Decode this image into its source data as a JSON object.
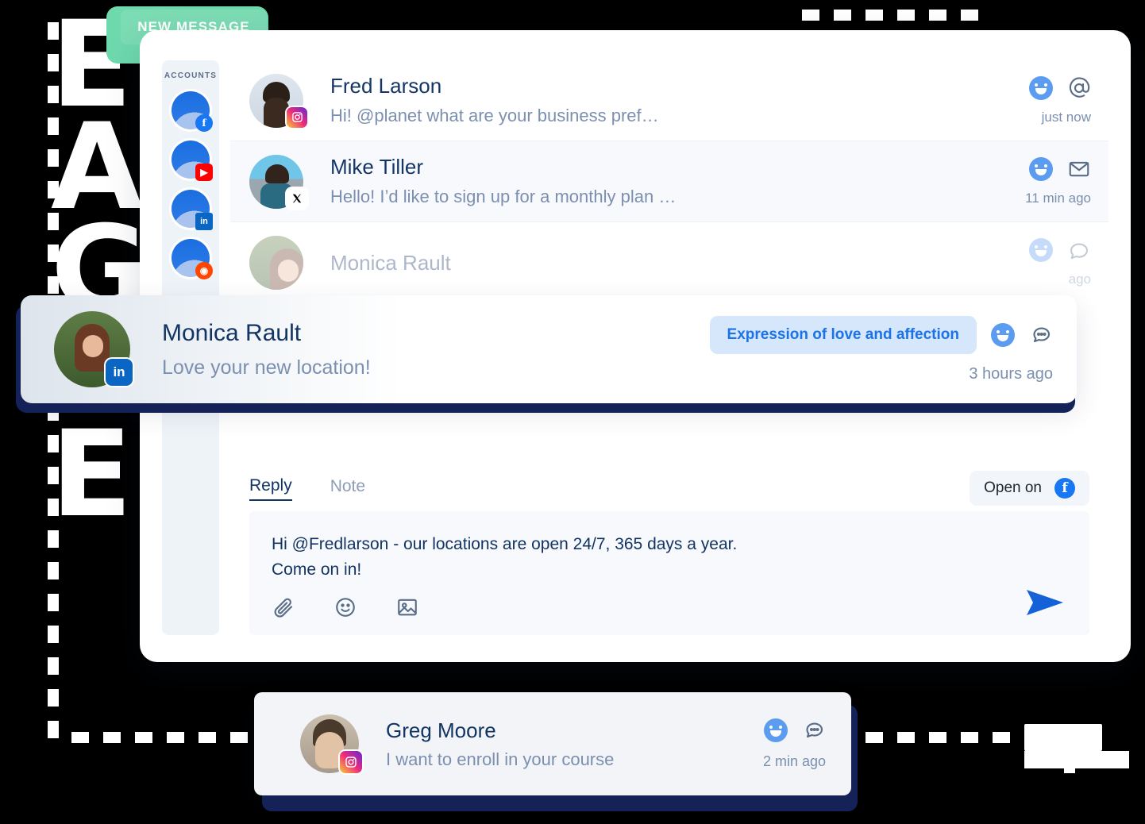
{
  "decor": {
    "ghost_letters": [
      "E",
      "A",
      "G",
      "E",
      "E"
    ],
    "new_message_badge": "NEW MESSAGE"
  },
  "sidebar": {
    "title": "ACCOUNTS",
    "items": [
      {
        "name": "account-facebook",
        "badge_icon": "facebook-icon",
        "glyph": "f"
      },
      {
        "name": "account-youtube",
        "badge_icon": "youtube-icon",
        "glyph": "▶"
      },
      {
        "name": "account-linkedin",
        "badge_icon": "linkedin-icon",
        "glyph": "in"
      },
      {
        "name": "account-reddit",
        "badge_icon": "reddit-icon",
        "glyph": "◉"
      }
    ]
  },
  "conversations": [
    {
      "name": "Fred Larson",
      "snippet": "Hi! @planet what are your business pref…",
      "platform": "instagram-icon",
      "platform_glyph": "▣",
      "time": "just now",
      "icon_primary": "smiley-icon",
      "icon_secondary": "mention-at-icon"
    },
    {
      "name": "Mike Tiller",
      "snippet": "Hello! I’d like to sign up for a monthly plan …",
      "platform": "x-twitter-icon",
      "platform_glyph": "𝕏",
      "time": "11 min ago",
      "icon_primary": "smiley-icon",
      "icon_secondary": "envelope-icon"
    },
    {
      "name": "Monica Rault",
      "snippet": "",
      "platform": "linkedin-icon",
      "platform_glyph": "in",
      "time": "ago",
      "icon_primary": "smiley-icon",
      "icon_secondary": "chat-bubble-icon"
    }
  ],
  "monica_card": {
    "name": "Monica Rault",
    "snippet": "Love your new location!",
    "platform": "linkedin-icon",
    "platform_glyph": "in",
    "sentiment_tag": "Expression of love and affection",
    "time": "3 hours ago"
  },
  "composer": {
    "tabs": [
      {
        "label": "Reply",
        "active": true
      },
      {
        "label": "Note",
        "active": false
      }
    ],
    "open_on_label": "Open on",
    "open_on_platform": "facebook-icon",
    "open_on_glyph": "f",
    "reply_line_1": "Hi @Fredlarson - our locations are open 24/7, 365 days a year.",
    "reply_line_2": "Come on in!",
    "tools": [
      "attachment-icon",
      "emoji-icon",
      "image-icon"
    ],
    "send_icon": "send-icon"
  },
  "greg_card": {
    "name": "Greg Moore",
    "snippet": "I want to enroll in your course",
    "platform": "instagram-icon",
    "platform_glyph": "▣",
    "time": "2 min ago",
    "icon_primary": "smiley-icon",
    "icon_secondary": "chat-bubble-icon"
  },
  "colors": {
    "accent_blue": "#1a73e8",
    "smiley_blue": "#5b9bf0",
    "name_navy": "#123463",
    "muted_text": "#7b8fb0",
    "badge_green": "#7cdcb4",
    "tag_bg": "#d6e6fb"
  }
}
